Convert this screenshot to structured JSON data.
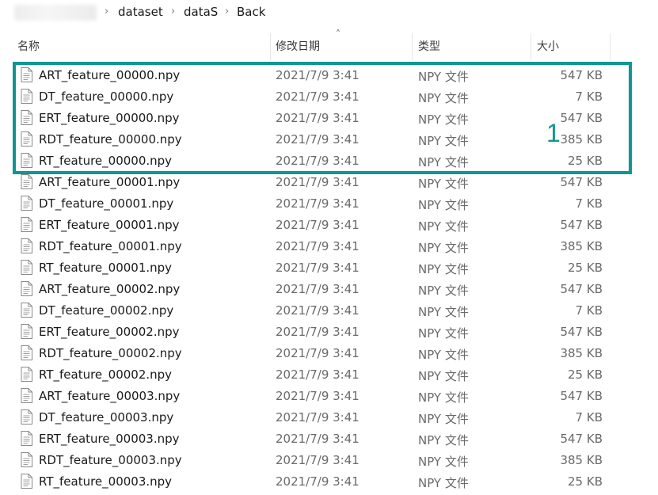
{
  "breadcrumb": {
    "items": [
      "dataset",
      "dataS",
      "Back"
    ]
  },
  "columns": {
    "name": "名称",
    "modified": "修改日期",
    "type": "类型",
    "size": "大小"
  },
  "files": [
    {
      "name": "ART_feature_00000.npy",
      "modified": "2021/7/9 3:41",
      "type": "NPY 文件",
      "size": "547 KB"
    },
    {
      "name": "DT_feature_00000.npy",
      "modified": "2021/7/9 3:41",
      "type": "NPY 文件",
      "size": "7 KB"
    },
    {
      "name": "ERT_feature_00000.npy",
      "modified": "2021/7/9 3:41",
      "type": "NPY 文件",
      "size": "547 KB"
    },
    {
      "name": "RDT_feature_00000.npy",
      "modified": "2021/7/9 3:41",
      "type": "NPY 文件",
      "size": "385 KB"
    },
    {
      "name": "RT_feature_00000.npy",
      "modified": "2021/7/9 3:41",
      "type": "NPY 文件",
      "size": "25 KB"
    },
    {
      "name": "ART_feature_00001.npy",
      "modified": "2021/7/9 3:41",
      "type": "NPY 文件",
      "size": "547 KB"
    },
    {
      "name": "DT_feature_00001.npy",
      "modified": "2021/7/9 3:41",
      "type": "NPY 文件",
      "size": "7 KB"
    },
    {
      "name": "ERT_feature_00001.npy",
      "modified": "2021/7/9 3:41",
      "type": "NPY 文件",
      "size": "547 KB"
    },
    {
      "name": "RDT_feature_00001.npy",
      "modified": "2021/7/9 3:41",
      "type": "NPY 文件",
      "size": "385 KB"
    },
    {
      "name": "RT_feature_00001.npy",
      "modified": "2021/7/9 3:41",
      "type": "NPY 文件",
      "size": "25 KB"
    },
    {
      "name": "ART_feature_00002.npy",
      "modified": "2021/7/9 3:41",
      "type": "NPY 文件",
      "size": "547 KB"
    },
    {
      "name": "DT_feature_00002.npy",
      "modified": "2021/7/9 3:41",
      "type": "NPY 文件",
      "size": "7 KB"
    },
    {
      "name": "ERT_feature_00002.npy",
      "modified": "2021/7/9 3:41",
      "type": "NPY 文件",
      "size": "547 KB"
    },
    {
      "name": "RDT_feature_00002.npy",
      "modified": "2021/7/9 3:41",
      "type": "NPY 文件",
      "size": "385 KB"
    },
    {
      "name": "RT_feature_00002.npy",
      "modified": "2021/7/9 3:41",
      "type": "NPY 文件",
      "size": "25 KB"
    },
    {
      "name": "ART_feature_00003.npy",
      "modified": "2021/7/9 3:41",
      "type": "NPY 文件",
      "size": "547 KB"
    },
    {
      "name": "DT_feature_00003.npy",
      "modified": "2021/7/9 3:41",
      "type": "NPY 文件",
      "size": "7 KB"
    },
    {
      "name": "ERT_feature_00003.npy",
      "modified": "2021/7/9 3:41",
      "type": "NPY 文件",
      "size": "547 KB"
    },
    {
      "name": "RDT_feature_00003.npy",
      "modified": "2021/7/9 3:41",
      "type": "NPY 文件",
      "size": "385 KB"
    },
    {
      "name": "RT_feature_00003.npy",
      "modified": "2021/7/9 3:41",
      "type": "NPY 文件",
      "size": "25 KB"
    }
  ],
  "annotation": {
    "label": "1",
    "color": "#0e9691"
  },
  "icons": {
    "file": "file-icon",
    "separator": "chevron-right-icon",
    "sort": "sort-up-icon"
  }
}
